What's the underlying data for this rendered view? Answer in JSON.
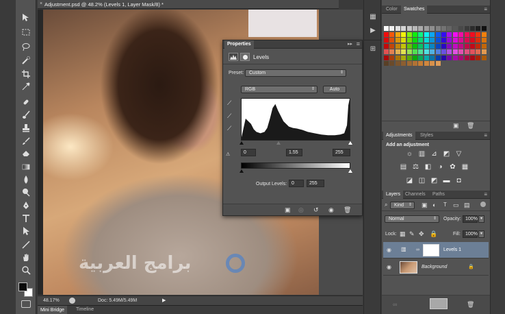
{
  "document": {
    "title": "Adjustment.psd @ 48.2% (Levels 1, Layer Mask/8) *",
    "close_glyph": "×"
  },
  "toolbar": {
    "tools": [
      "move-tool",
      "marquee-tool",
      "lasso-tool",
      "quick-selection-tool",
      "crop-tool",
      "eyedropper-tool",
      "healing-brush-tool",
      "brush-tool",
      "clone-stamp-tool",
      "history-brush-tool",
      "eraser-tool",
      "gradient-tool",
      "blur-tool",
      "dodge-tool",
      "pen-tool",
      "type-tool",
      "path-selection-tool",
      "shape-tool",
      "hand-tool",
      "zoom-tool"
    ]
  },
  "status": {
    "zoom": "48.17%",
    "doc_info": "Doc: 5.49M/5.49M"
  },
  "bottom_tabs": [
    "Mini Bridge",
    "Timeline"
  ],
  "properties": {
    "tab": "Properties",
    "adjustment_name": "Levels",
    "preset_label": "Preset:",
    "preset_value": "Custom",
    "channel": "RGB",
    "auto_label": "Auto",
    "input_black": "0",
    "input_gamma": "1.55",
    "input_white": "255",
    "output_label": "Output Levels:",
    "output_black": "0",
    "output_white": "255"
  },
  "swatches_panel": {
    "tabs": [
      "Color",
      "Swatches"
    ],
    "active_tab": "Swatches"
  },
  "adjustments_panel": {
    "tabs": [
      "Adjustments",
      "Styles"
    ],
    "heading": "Add an adjustment"
  },
  "layers_panel": {
    "tabs": [
      "Layers",
      "Channels",
      "Paths"
    ],
    "filter_kind": "Kind",
    "blend_mode": "Normal",
    "opacity_label": "Opacity:",
    "opacity_value": "100%",
    "lock_label": "Lock:",
    "fill_label": "Fill:",
    "fill_value": "100%",
    "layers": [
      {
        "name": "Levels 1",
        "selected": true
      },
      {
        "name": "Background",
        "selected": false
      }
    ]
  },
  "watermark": "برامج العربية",
  "colors": {
    "panel_bg": "#535353",
    "dark_bg": "#3a3a3a",
    "selected_layer": "#6c7f96"
  }
}
